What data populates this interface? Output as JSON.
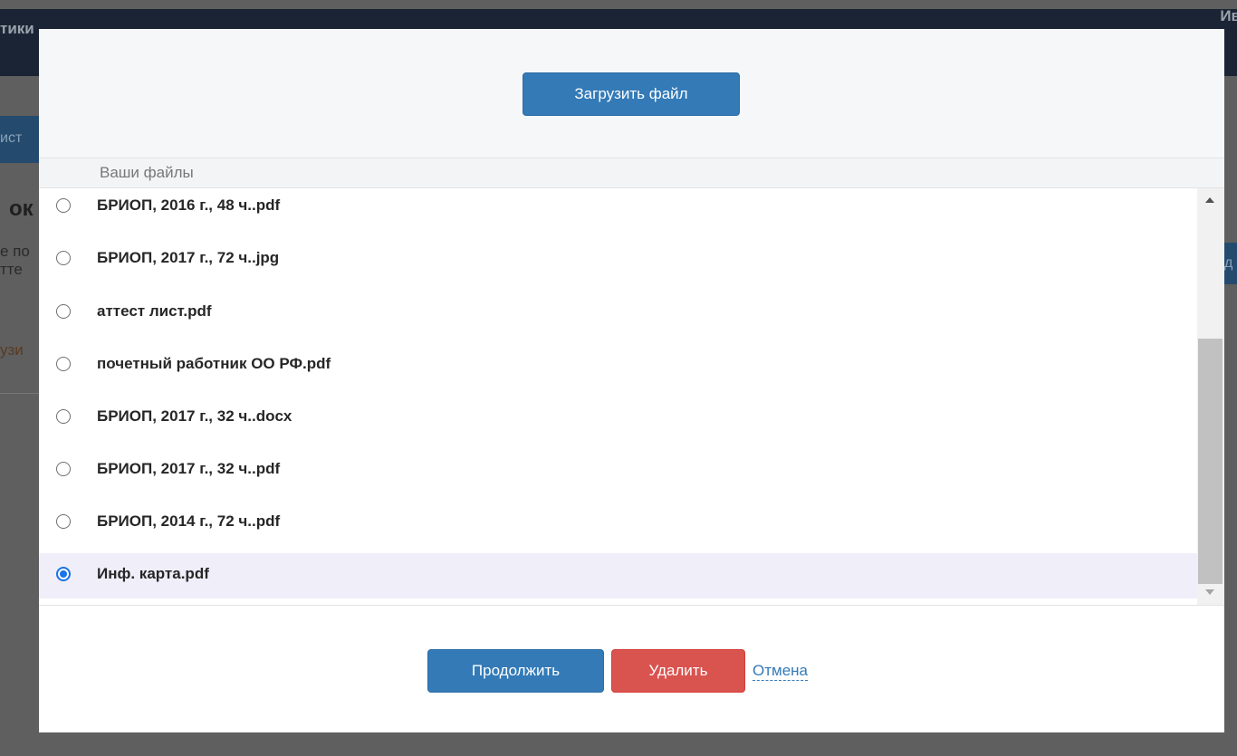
{
  "background": {
    "topbar_left_text": "тики",
    "topbar_right_text": "Ив",
    "tab_text": "ист",
    "heading_text": "ок",
    "text_line1": "е по",
    "text_line2": "тте",
    "link_text": "узи",
    "right_button_text": "д"
  },
  "modal": {
    "upload_button_label": "Загрузить файл",
    "files_header": "Ваши файлы",
    "files": [
      {
        "name": "БРИОП, 2016 г., 48 ч..pdf",
        "selected": false
      },
      {
        "name": "БРИОП, 2017 г., 72 ч..jpg",
        "selected": false
      },
      {
        "name": "аттест лист.pdf",
        "selected": false
      },
      {
        "name": "почетный работник ОО РФ.pdf",
        "selected": false
      },
      {
        "name": "БРИОП, 2017 г., 32 ч..docx",
        "selected": false
      },
      {
        "name": "БРИОП, 2017 г., 32 ч..pdf",
        "selected": false
      },
      {
        "name": "БРИОП, 2014 г., 72 ч..pdf",
        "selected": false
      },
      {
        "name": "Инф. карта.pdf",
        "selected": true
      }
    ],
    "continue_label": "Продолжить",
    "delete_label": "Удалить",
    "cancel_label": "Отмена",
    "colors": {
      "primary": "#337ab7",
      "danger": "#d9534f",
      "selected_row": "#efeef9",
      "radio_checked": "#1a73e8"
    }
  }
}
